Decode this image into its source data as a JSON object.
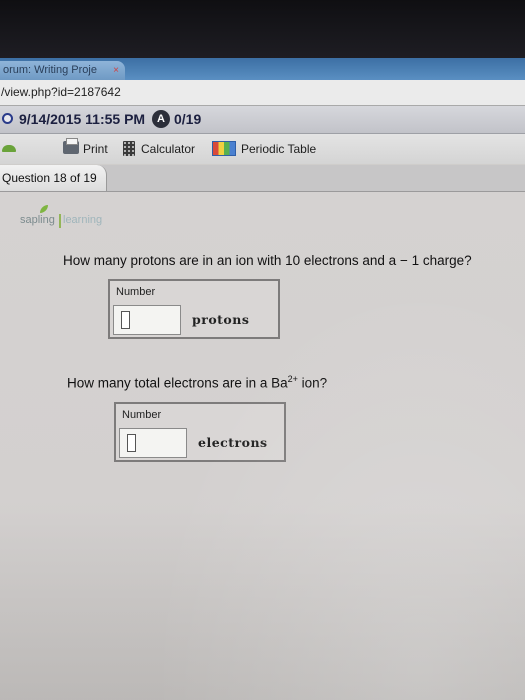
{
  "browser": {
    "tab_title": "orum: Writing Proje",
    "tab_close": "×",
    "url": "/view.php?id=2187642"
  },
  "header": {
    "datetime": "9/14/2015 11:55 PM",
    "attempt_icon": "A",
    "score": "0/19"
  },
  "toolbar": {
    "print_label": "Print",
    "calculator_label": "Calculator",
    "periodic_table_label": "Periodic Table",
    "icons": [
      "printer-icon",
      "calculator-icon",
      "periodic-table-icon"
    ]
  },
  "question_nav": {
    "label": "Question 18 of 19"
  },
  "logo": {
    "sapling": "sapling",
    "learning": "learning"
  },
  "questions": [
    {
      "text": "How many protons are in an ion with 10 electrons and a − 1 charge?",
      "field_label": "Number",
      "value": "",
      "unit": "protons"
    },
    {
      "text_before": "How many total electrons are in a Ba",
      "superscript": "2+",
      "text_after": " ion?",
      "field_label": "Number",
      "value": "",
      "unit": "electrons"
    }
  ],
  "colors": {
    "tab_blue": "#5a8fc2",
    "brand_green": "#7fb541",
    "content_bg": "#d5d2d1"
  }
}
